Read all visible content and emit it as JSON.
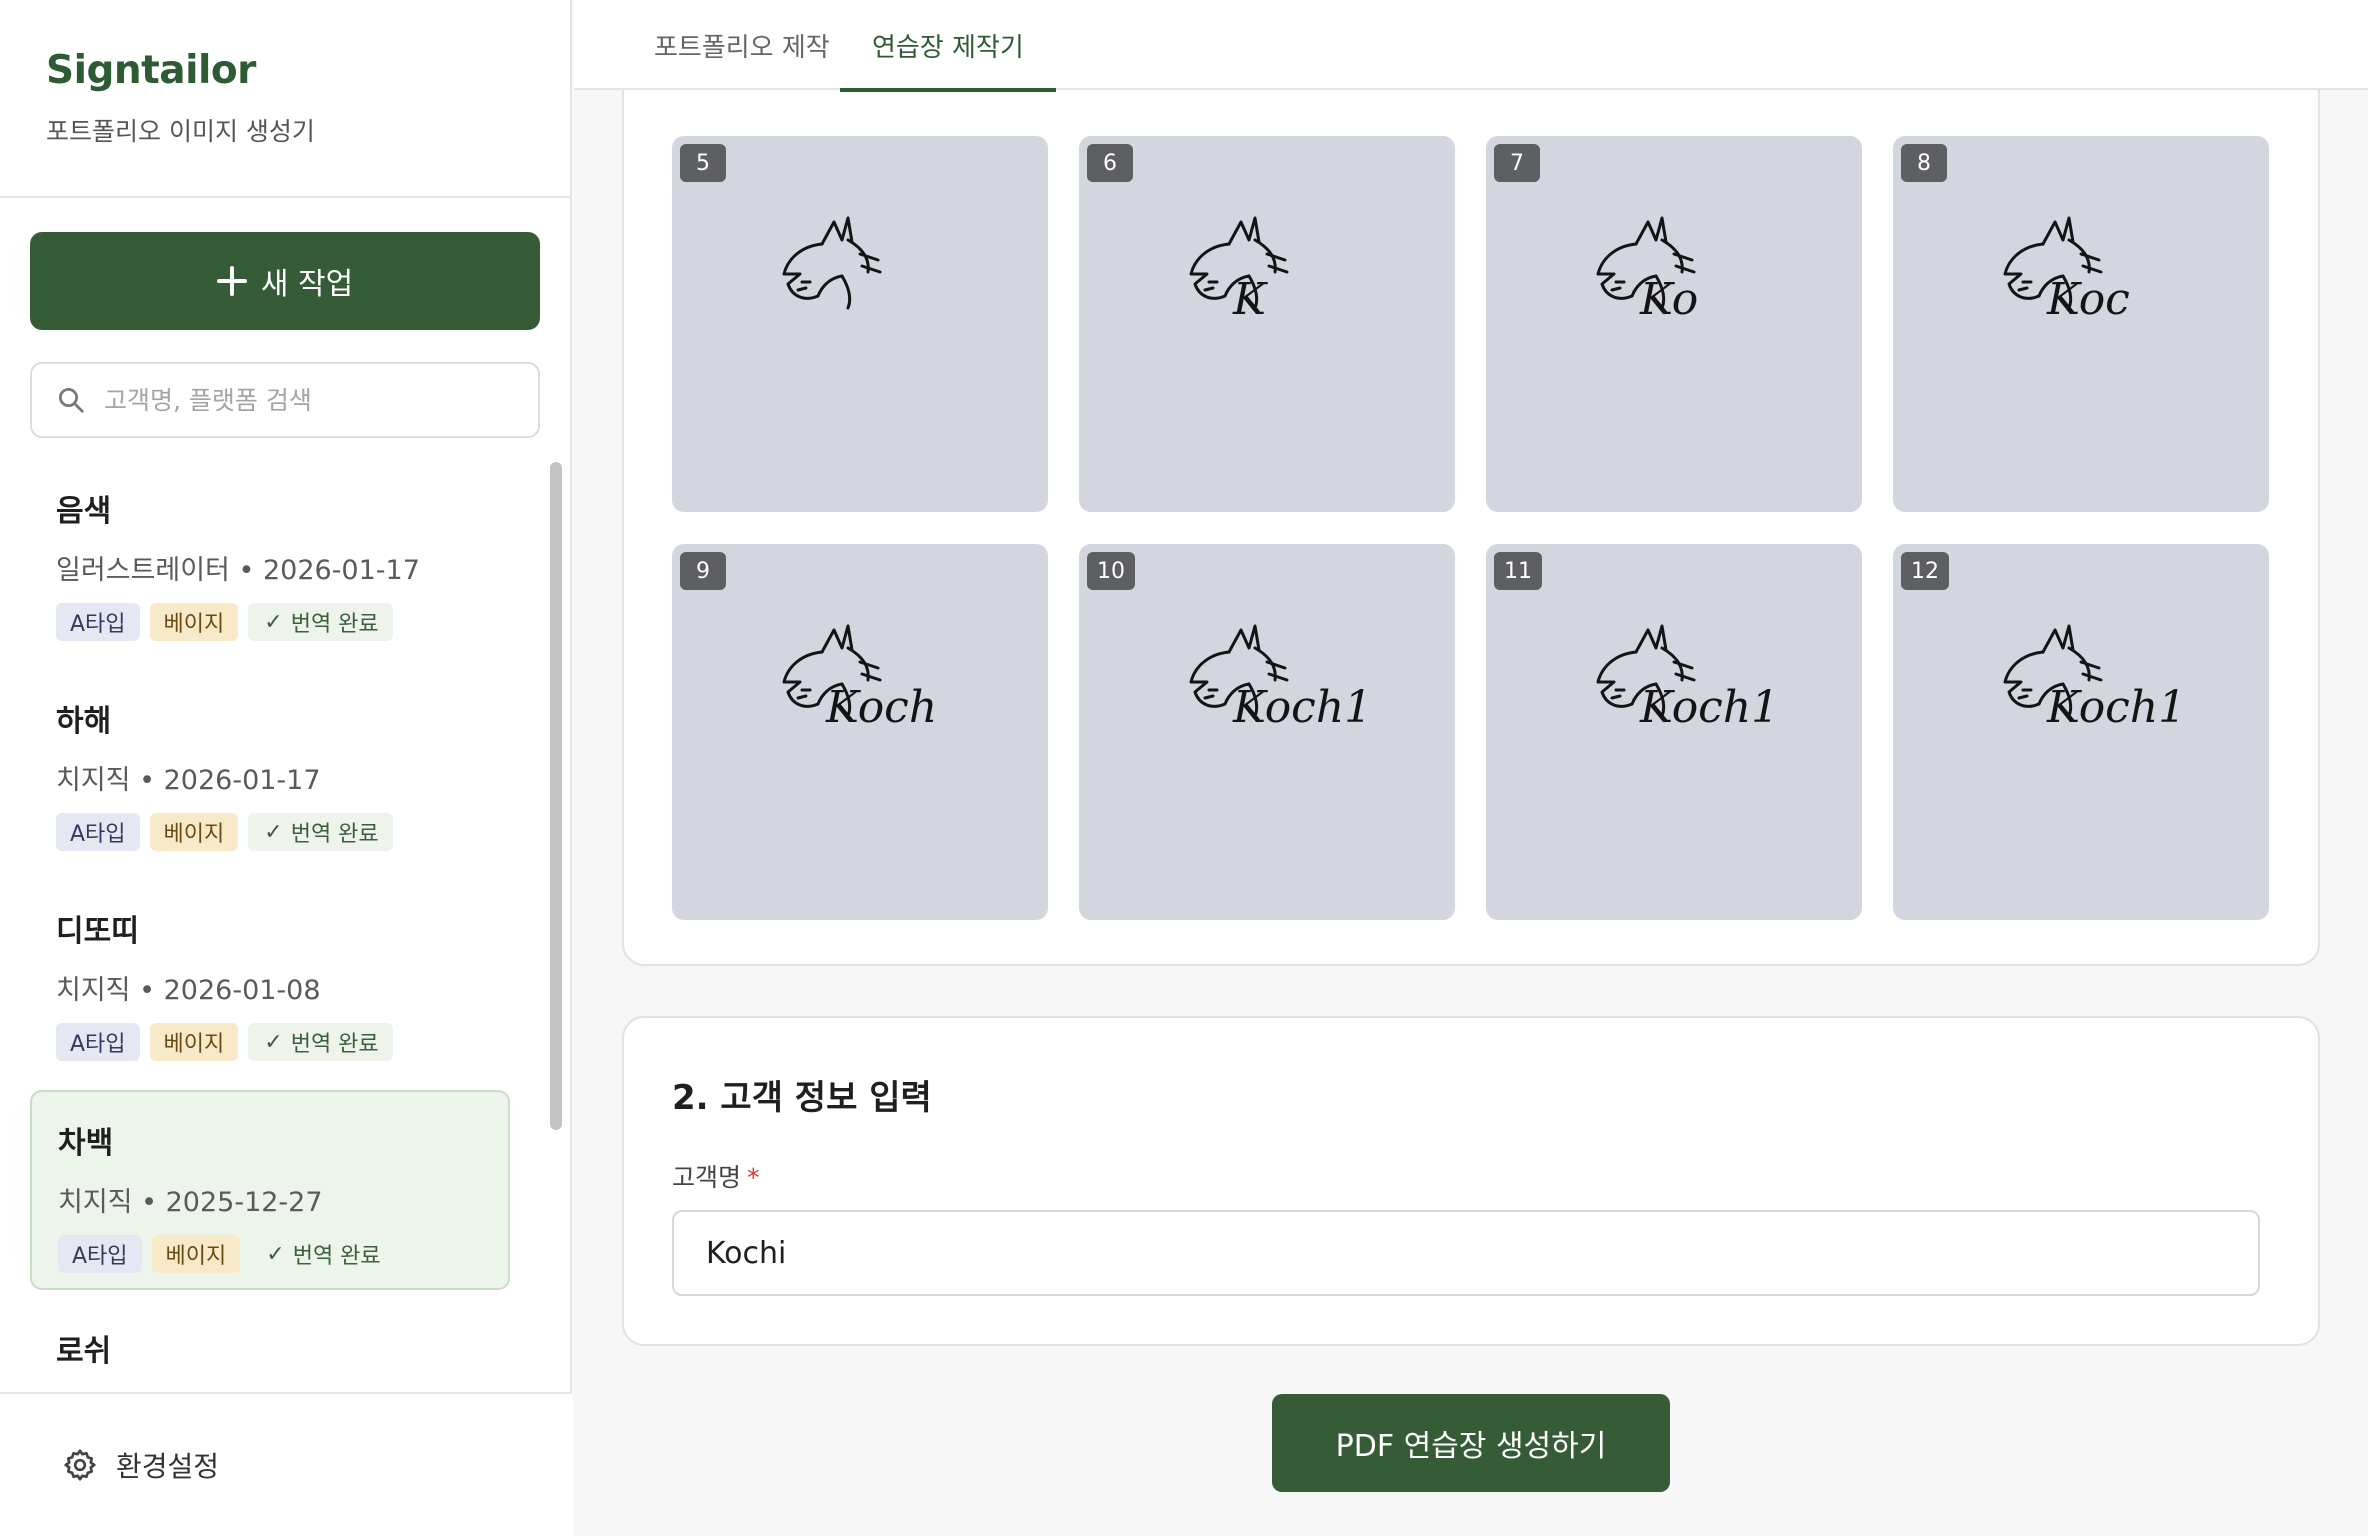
{
  "sidebar": {
    "brand": "Signtailor",
    "subtitle": "포트폴리오 이미지 생성기",
    "new_button": "새 작업",
    "search_placeholder": "고객명, 플랫폼 검색",
    "items": [
      {
        "name": "음색",
        "meta": "일러스트레이터 • 2026-01-17",
        "tags": [
          "A타입",
          "베이지",
          "번역 완료"
        ],
        "selected": false
      },
      {
        "name": "하해",
        "meta": "치지직 • 2026-01-17",
        "tags": [
          "A타입",
          "베이지",
          "번역 완료"
        ],
        "selected": false
      },
      {
        "name": "디또띠",
        "meta": "치지직 • 2026-01-08",
        "tags": [
          "A타입",
          "베이지",
          "번역 완료"
        ],
        "selected": false
      },
      {
        "name": "차백",
        "meta": "치지직 • 2025-12-27",
        "tags": [
          "A타입",
          "베이지",
          "번역 완료"
        ],
        "selected": true
      },
      {
        "name": "로쉬",
        "meta": "",
        "tags": [],
        "selected": false
      }
    ],
    "settings_label": "환경설정"
  },
  "tabs": [
    {
      "label": "포트폴리오 제작",
      "active": false
    },
    {
      "label": "연습장 제작기",
      "active": true
    }
  ],
  "steps": {
    "tiles": [
      {
        "number": "5",
        "signature_text": ""
      },
      {
        "number": "6",
        "signature_text": "K"
      },
      {
        "number": "7",
        "signature_text": "Ko"
      },
      {
        "number": "8",
        "signature_text": "Koc"
      },
      {
        "number": "9",
        "signature_text": "Koch"
      },
      {
        "number": "10",
        "signature_text": "Koch1"
      },
      {
        "number": "11",
        "signature_text": "Koch1"
      },
      {
        "number": "12",
        "signature_text": "Koch1"
      }
    ]
  },
  "customer_section": {
    "title": "2. 고객 정보 입력",
    "field_label": "고객명",
    "required_mark": "*",
    "field_value": "Kochi"
  },
  "generate_button": "PDF 연습장 생성하기",
  "colors": {
    "brand_green": "#355c37",
    "tile_bg": "#d3d5df",
    "selected_item_bg": "#edf4ec",
    "required_red": "#d93a3a"
  }
}
